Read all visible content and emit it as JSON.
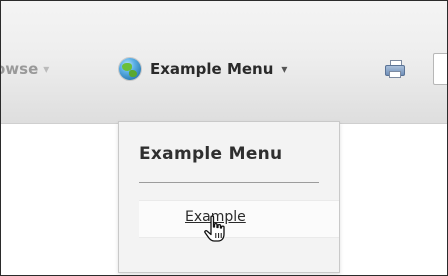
{
  "toolbar": {
    "browse": {
      "label": "owse",
      "caret": "▾"
    },
    "menu": {
      "label": "Example Menu",
      "caret": "▾",
      "icon": "globe-icon"
    },
    "print_icon": "printer-icon",
    "search_icon": "search-box"
  },
  "dropdown": {
    "title": "Example Menu",
    "items": [
      {
        "label": "Example"
      }
    ]
  },
  "cursor": {
    "icon": "hand-pointer-cursor"
  },
  "colors": {
    "toolbar_top": "#f4f4f4",
    "toolbar_bottom": "#dedede",
    "dropdown_bg": "#f3f3f3",
    "item_bg": "#fbfbfb",
    "text": "#2a2a2a",
    "muted": "#999999"
  }
}
